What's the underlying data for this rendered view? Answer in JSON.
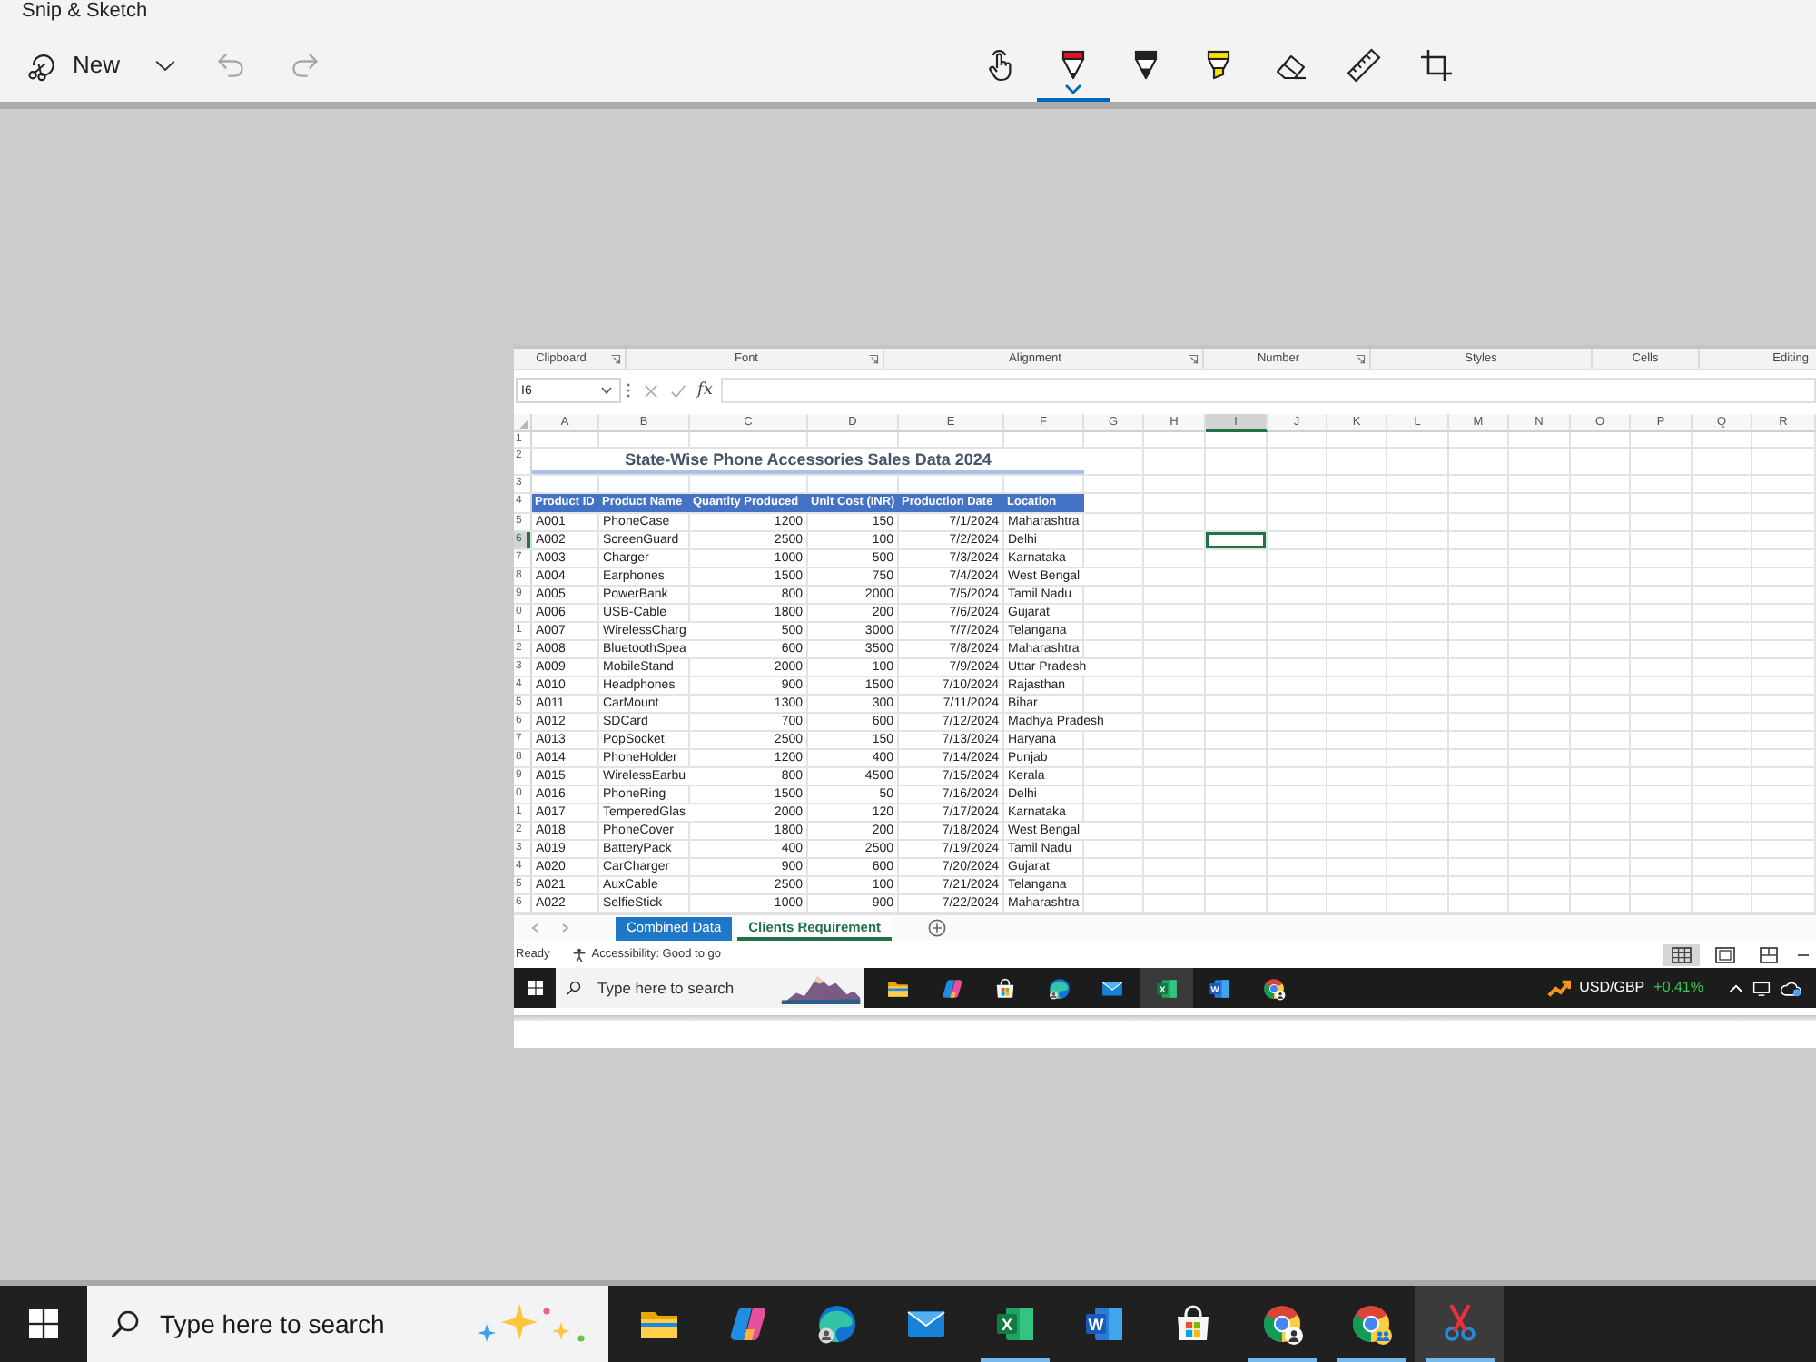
{
  "window": {
    "title": "Snip & Sketch"
  },
  "toolbar": {
    "new_label": "New",
    "undo": {
      "disabled": true
    },
    "redo": {
      "disabled": true
    },
    "tools": [
      {
        "kind": "touch",
        "selected": false
      },
      {
        "kind": "ballpoint",
        "selected": true
      },
      {
        "kind": "pencil",
        "selected": false
      },
      {
        "kind": "highlighter",
        "selected": false
      },
      {
        "kind": "eraser",
        "selected": false
      },
      {
        "kind": "ruler",
        "selected": false
      },
      {
        "kind": "crop",
        "selected": false
      }
    ]
  },
  "screenshot": {
    "ribbon_groups": [
      {
        "label": "Clipboard",
        "launcher": true
      },
      {
        "label": "Font",
        "launcher": true
      },
      {
        "label": "Alignment",
        "launcher": true
      },
      {
        "label": "Number",
        "launcher": true
      },
      {
        "label": "Styles",
        "launcher": false
      },
      {
        "label": "Cells",
        "launcher": false
      },
      {
        "label": "Editing",
        "launcher": false
      }
    ],
    "name_box": {
      "value": "I6"
    },
    "function_button": "fx",
    "column_headers": [
      {
        "label": "A",
        "selected": false
      },
      {
        "label": "B",
        "selected": false
      },
      {
        "label": "C",
        "selected": false
      },
      {
        "label": "D",
        "selected": false
      },
      {
        "label": "E",
        "selected": false
      },
      {
        "label": "F",
        "selected": false
      },
      {
        "label": "G",
        "selected": false
      },
      {
        "label": "H",
        "selected": false
      },
      {
        "label": "I",
        "selected": true
      },
      {
        "label": "J",
        "selected": false
      },
      {
        "label": "K",
        "selected": false
      },
      {
        "label": "L",
        "selected": false
      },
      {
        "label": "M",
        "selected": false
      },
      {
        "label": "N",
        "selected": false
      },
      {
        "label": "O",
        "selected": false
      },
      {
        "label": "P",
        "selected": false
      },
      {
        "label": "Q",
        "selected": false
      },
      {
        "label": "R",
        "selected": false
      }
    ],
    "row_headers": [
      {
        "label": "1",
        "selected": false
      },
      {
        "label": "2",
        "selected": false
      },
      {
        "label": "3",
        "selected": false
      },
      {
        "label": "4",
        "selected": false
      },
      {
        "label": "5",
        "selected": false
      },
      {
        "label": "6",
        "selected": true
      },
      {
        "label": "7",
        "selected": false
      },
      {
        "label": "8",
        "selected": false
      },
      {
        "label": "9",
        "selected": false
      },
      {
        "label": "0",
        "selected": false
      },
      {
        "label": "1",
        "selected": false
      },
      {
        "label": "2",
        "selected": false
      },
      {
        "label": "3",
        "selected": false
      },
      {
        "label": "4",
        "selected": false
      },
      {
        "label": "5",
        "selected": false
      },
      {
        "label": "6",
        "selected": false
      },
      {
        "label": "7",
        "selected": false
      },
      {
        "label": "8",
        "selected": false
      },
      {
        "label": "9",
        "selected": false
      },
      {
        "label": "0",
        "selected": false
      },
      {
        "label": "1",
        "selected": false
      },
      {
        "label": "2",
        "selected": false
      },
      {
        "label": "3",
        "selected": false
      },
      {
        "label": "4",
        "selected": false
      },
      {
        "label": "5",
        "selected": false
      },
      {
        "label": "6",
        "selected": false
      }
    ],
    "title": "State-Wise Phone Accessories Sales Data 2024",
    "table": {
      "headers": [
        "Product ID",
        "Product Name",
        "Quantity Produced",
        "Unit Cost (INR)",
        "Production Date",
        "Location"
      ],
      "rows": [
        [
          "A001",
          "PhoneCase",
          "1200",
          "150",
          "7/1/2024",
          "Maharashtra"
        ],
        [
          "A002",
          "ScreenGuard",
          "2500",
          "100",
          "7/2/2024",
          "Delhi"
        ],
        [
          "A003",
          "Charger",
          "1000",
          "500",
          "7/3/2024",
          "Karnataka"
        ],
        [
          "A004",
          "Earphones",
          "1500",
          "750",
          "7/4/2024",
          "West Bengal"
        ],
        [
          "A005",
          "PowerBank",
          "800",
          "2000",
          "7/5/2024",
          "Tamil Nadu"
        ],
        [
          "A006",
          "USB-Cable",
          "1800",
          "200",
          "7/6/2024",
          "Gujarat"
        ],
        [
          "A007",
          "WirelessCharg",
          "500",
          "3000",
          "7/7/2024",
          "Telangana"
        ],
        [
          "A008",
          "BluetoothSpea",
          "600",
          "3500",
          "7/8/2024",
          "Maharashtra"
        ],
        [
          "A009",
          "MobileStand",
          "2000",
          "100",
          "7/9/2024",
          "Uttar Pradesh"
        ],
        [
          "A010",
          "Headphones",
          "900",
          "1500",
          "7/10/2024",
          "Rajasthan"
        ],
        [
          "A011",
          "CarMount",
          "1300",
          "300",
          "7/11/2024",
          "Bihar"
        ],
        [
          "A012",
          "SDCard",
          "700",
          "600",
          "7/12/2024",
          "Madhya Pradesh"
        ],
        [
          "A013",
          "PopSocket",
          "2500",
          "150",
          "7/13/2024",
          "Haryana"
        ],
        [
          "A014",
          "PhoneHolder",
          "1200",
          "400",
          "7/14/2024",
          "Punjab"
        ],
        [
          "A015",
          "WirelessEarbu",
          "800",
          "4500",
          "7/15/2024",
          "Kerala"
        ],
        [
          "A016",
          "PhoneRing",
          "1500",
          "50",
          "7/16/2024",
          "Delhi"
        ],
        [
          "A017",
          "TemperedGlas",
          "2000",
          "120",
          "7/17/2024",
          "Karnataka"
        ],
        [
          "A018",
          "PhoneCover",
          "1800",
          "200",
          "7/18/2024",
          "West Bengal"
        ],
        [
          "A019",
          "BatteryPack",
          "400",
          "2500",
          "7/19/2024",
          "Tamil Nadu"
        ],
        [
          "A020",
          "CarCharger",
          "900",
          "600",
          "7/20/2024",
          "Gujarat"
        ],
        [
          "A021",
          "AuxCable",
          "2500",
          "100",
          "7/21/2024",
          "Telangana"
        ],
        [
          "A022",
          "SelfieStick",
          "1000",
          "900",
          "7/22/2024",
          "Maharashtra"
        ]
      ]
    },
    "sheet_tabs": [
      {
        "label": "Combined Data",
        "selected": false,
        "color": "#1f77c8"
      },
      {
        "label": "Clients Requirement",
        "selected": true
      }
    ],
    "status": "Ready",
    "accessibility": "Accessibility: Good to go",
    "views": [
      {
        "kind": "normal",
        "selected": true
      },
      {
        "kind": "page_layout",
        "selected": false
      },
      {
        "kind": "page_break",
        "selected": false
      }
    ],
    "taskbar": {
      "search": {
        "placeholder": "Type here to search"
      },
      "apps": [
        {
          "kind": "explorer",
          "active": false
        },
        {
          "kind": "copilot",
          "active": false
        },
        {
          "kind": "store",
          "active": false
        },
        {
          "kind": "edge",
          "active": false
        },
        {
          "kind": "mail",
          "active": false
        },
        {
          "kind": "excel",
          "letter": "X",
          "active": true
        },
        {
          "kind": "word",
          "letter": "W",
          "active": false
        },
        {
          "kind": "chrome",
          "active": false
        }
      ],
      "ticker": {
        "symbol": "USD/GBP",
        "change": "+0.41%"
      }
    }
  },
  "taskbar": {
    "search": {
      "placeholder": "Type here to search"
    },
    "apps": [
      {
        "kind": "explorer",
        "running": false,
        "active": false
      },
      {
        "kind": "copilot",
        "running": false,
        "active": false
      },
      {
        "kind": "edge",
        "running": false,
        "active": false
      },
      {
        "kind": "mail",
        "running": false,
        "active": false
      },
      {
        "kind": "excel",
        "letter": "X",
        "running": true,
        "active": false
      },
      {
        "kind": "word",
        "letter": "W",
        "running": false,
        "active": false
      },
      {
        "kind": "store",
        "running": false,
        "active": false
      },
      {
        "kind": "chrome",
        "running": true,
        "active": false
      },
      {
        "kind": "chrome_group",
        "running": true,
        "active": false
      },
      {
        "kind": "snip",
        "running": true,
        "active": true
      }
    ]
  }
}
